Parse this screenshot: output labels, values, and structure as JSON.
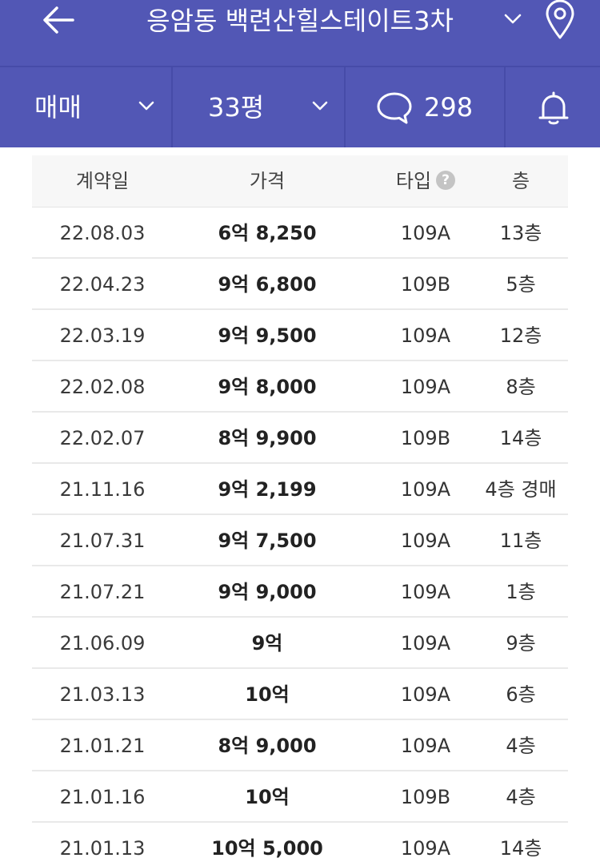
{
  "header": {
    "title": "응암동 백련산힐스테이트3차",
    "back_icon": "arrow-left-icon",
    "dropdown_icon": "chevron-down-icon",
    "location_icon": "map-pin-icon",
    "bg_color": "#5257b5"
  },
  "filters": {
    "trade_type": "매매",
    "size": "33평",
    "comment_count": "298",
    "comment_icon": "speech-bubble-icon",
    "bell_icon": "bell-icon"
  },
  "table": {
    "headers": {
      "date": "계약일",
      "price": "가격",
      "type": "타입",
      "type_help": "?",
      "floor": "층"
    },
    "rows": [
      {
        "date": "22.08.03",
        "price": "6억 8,250",
        "type": "109A",
        "floor": "13층"
      },
      {
        "date": "22.04.23",
        "price": "9억 6,800",
        "type": "109B",
        "floor": "5층"
      },
      {
        "date": "22.03.19",
        "price": "9억 9,500",
        "type": "109A",
        "floor": "12층"
      },
      {
        "date": "22.02.08",
        "price": "9억 8,000",
        "type": "109A",
        "floor": "8층"
      },
      {
        "date": "22.02.07",
        "price": "8억 9,900",
        "type": "109B",
        "floor": "14층"
      },
      {
        "date": "21.11.16",
        "price": "9억 2,199",
        "type": "109A",
        "floor": "4층 경매"
      },
      {
        "date": "21.07.31",
        "price": "9억 7,500",
        "type": "109A",
        "floor": "11층"
      },
      {
        "date": "21.07.21",
        "price": "9억 9,000",
        "type": "109A",
        "floor": "1층"
      },
      {
        "date": "21.06.09",
        "price": "9억",
        "type": "109A",
        "floor": "9층"
      },
      {
        "date": "21.03.13",
        "price": "10억",
        "type": "109A",
        "floor": "6층"
      },
      {
        "date": "21.01.21",
        "price": "8억 9,000",
        "type": "109A",
        "floor": "4층"
      },
      {
        "date": "21.01.16",
        "price": "10억",
        "type": "109B",
        "floor": "4층"
      },
      {
        "date": "21.01.13",
        "price": "10억 5,000",
        "type": "109A",
        "floor": "14층"
      }
    ]
  }
}
